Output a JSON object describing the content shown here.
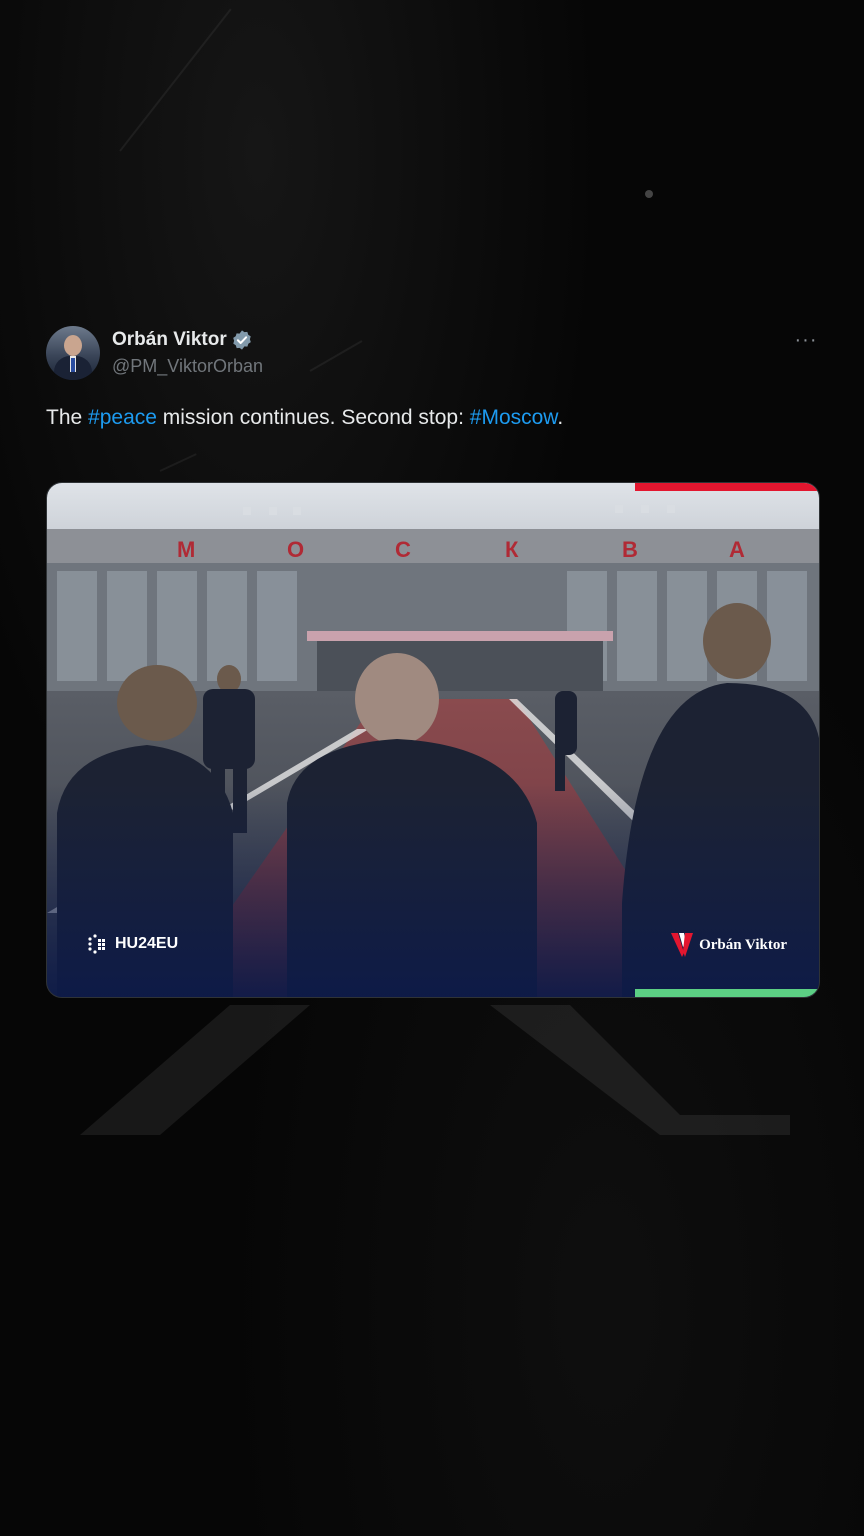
{
  "post": {
    "author": {
      "display_name": "Orbán Viktor",
      "handle": "@PM_ViktorOrban",
      "verified": true,
      "avatar_icon": "profile-photo-avatar"
    },
    "more_icon": "more-options-icon",
    "more_label": "···",
    "text_segments": [
      {
        "text": "The ",
        "type": "plain"
      },
      {
        "text": "#peace",
        "type": "hashtag"
      },
      {
        "text": " mission continues. Second stop: ",
        "type": "plain"
      },
      {
        "text": "#Moscow",
        "type": "hashtag"
      },
      {
        "text": ".",
        "type": "plain"
      }
    ],
    "media": {
      "sign_letters": [
        "М",
        "О",
        "С",
        "К",
        "В",
        "А"
      ],
      "watermark_left": "HU24EU",
      "watermark_right": "Orbán Viktor",
      "flag_colors": {
        "top": "#e3162f",
        "bottom": "#5ccf84"
      }
    }
  },
  "colors": {
    "background": "#060606",
    "text": "#e7e9ea",
    "secondary": "#71767b",
    "hashtag": "#1d9bf0",
    "verified": "#829aab"
  }
}
